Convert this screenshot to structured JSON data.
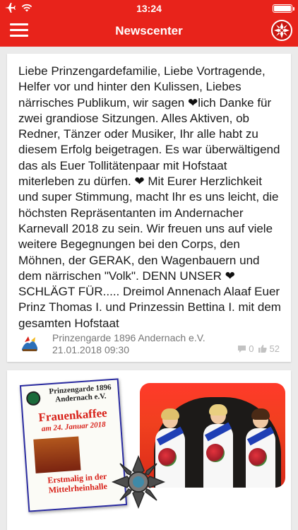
{
  "status_bar": {
    "time": "13:24",
    "airplane_icon": "airplane-icon",
    "wifi_icon": "wifi-icon",
    "battery_level": 1.0
  },
  "navbar": {
    "title": "Newscenter",
    "menu_icon": "hamburger-menu-icon",
    "logo_icon": "club-emblem-icon",
    "color": "#e8231b"
  },
  "posts": [
    {
      "text_parts": [
        "Liebe Prinzengardefamilie, Liebe Vortragende, Helfer vor und hinter den Kulissen, Liebes närrisches Publikum, wir sagen ",
        "lich Danke für zwei grandiose Sitzungen. Alles Aktiven, ob Redner, Tänzer oder Musiker, Ihr alle habt zu diesem Erfolg beigetragen. Es war überwältigend das als Euer Tollitätenpaar mit Hofstaat miterleben zu dürfen. ",
        " Mit Eurer Herzlichkeit und super Stimmung, macht Ihr es uns leicht, die höchsten Repräsentanten im Andernacher Karnevall 2018 zu sein. Wir freuen uns auf viele weitere Begegnungen bei den Corps, den Möhnen, der GERAK, den Wagenbauern und dem närrischen \"Volk\". DENN UNSER ",
        " SCHLÄGT FÜR..... Dreimol Annenach Alaaf Euer Prinz Thomas I. und Prinzessin Bettina I. mit dem gesamten Hofstaat"
      ],
      "heart_glyph": "❤",
      "author": "Prinzengarde 1896 Andernach e.V.",
      "date": "21.01.2018 09:30",
      "comments_count": "0",
      "likes_count": "52"
    }
  ],
  "flyer": {
    "organization": "Prinzengarde 1896 Andernach e.V.",
    "event": "Frauenkaffee",
    "event_date": "am 24. Januar 2018",
    "headline": "Erstmalig in der Mittelrheinhalle"
  }
}
